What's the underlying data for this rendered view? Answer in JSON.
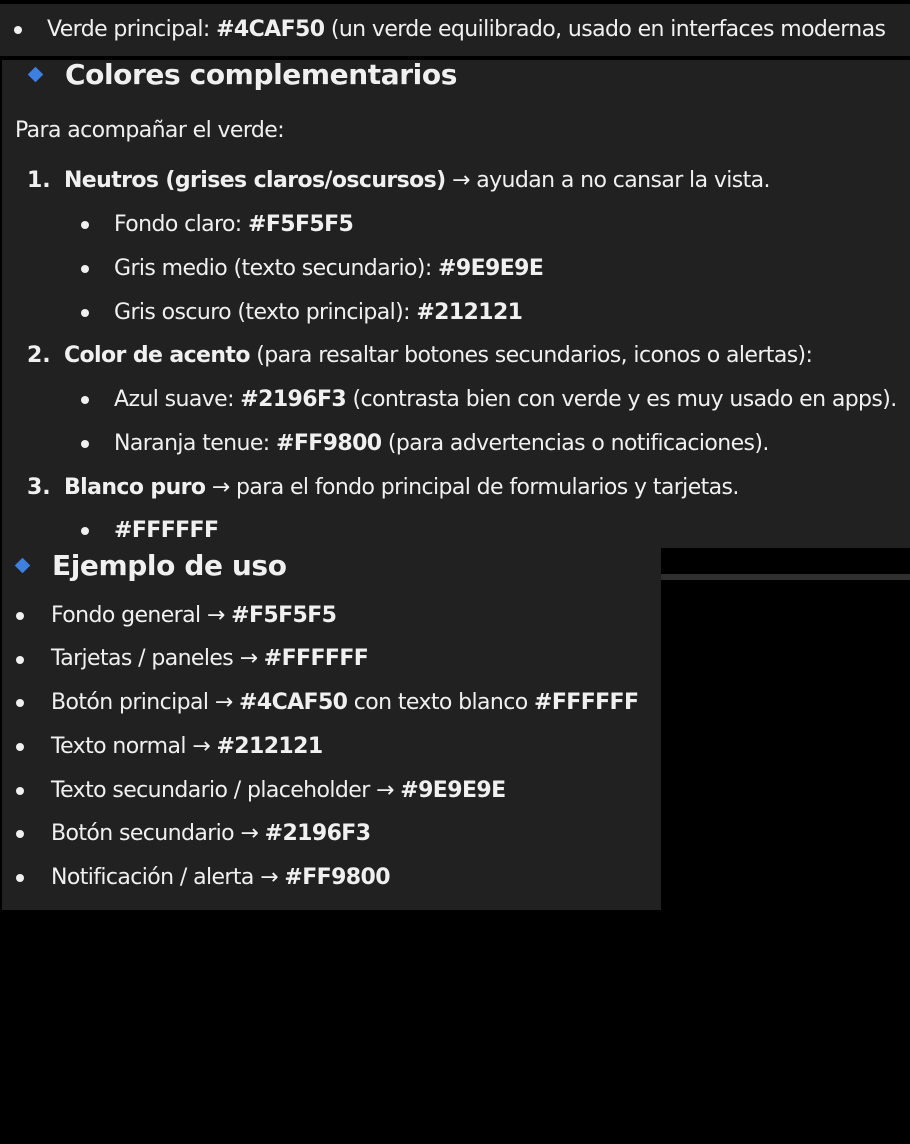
{
  "top_item": {
    "label": "Verde principal: ",
    "code": "#4CAF50",
    "rest": " (un verde equilibrado, usado en interfaces modernas"
  },
  "section1": {
    "heading": "Colores complementarios",
    "intro": "Para acompañar el verde:",
    "groups": [
      {
        "number": "1.",
        "title": "Neutros (grises claros/oscursos)",
        "rest": " → ayudan a no cansar la vista.",
        "items": [
          {
            "label": "Fondo claro: ",
            "code": "#F5F5F5",
            "rest": ""
          },
          {
            "label": "Gris medio (texto secundario): ",
            "code": "#9E9E9E",
            "rest": ""
          },
          {
            "label": "Gris oscuro (texto principal): ",
            "code": "#212121",
            "rest": ""
          }
        ]
      },
      {
        "number": "2.",
        "title": "Color de acento",
        "rest": " (para resaltar botones secundarios, iconos o alertas):",
        "items": [
          {
            "label": "Azul suave: ",
            "code": "#2196F3",
            "rest": " (contrasta bien con verde y es muy usado en apps)."
          },
          {
            "label": "Naranja tenue: ",
            "code": "#FF9800",
            "rest": " (para advertencias o notificaciones)."
          }
        ]
      },
      {
        "number": "3.",
        "title": "Blanco puro",
        "rest": " → para el fondo principal de formularios y tarjetas.",
        "items": [
          {
            "label": "",
            "code": "#FFFFFF",
            "rest": ""
          }
        ]
      }
    ]
  },
  "section2": {
    "heading": "Ejemplo de uso",
    "items": [
      {
        "label": "Fondo general → ",
        "code": "#F5F5F5",
        "rest": "",
        "code2": ""
      },
      {
        "label": "Tarjetas / paneles → ",
        "code": "#FFFFFF",
        "rest": "",
        "code2": ""
      },
      {
        "label": "Botón principal → ",
        "code": "#4CAF50",
        "rest": " con texto blanco ",
        "code2": "#FFFFFF"
      },
      {
        "label": "Texto normal → ",
        "code": "#212121",
        "rest": "",
        "code2": ""
      },
      {
        "label": "Texto secundario / placeholder → ",
        "code": "#9E9E9E",
        "rest": "",
        "code2": ""
      },
      {
        "label": "Botón secundario → ",
        "code": "#2196F3",
        "rest": "",
        "code2": ""
      },
      {
        "label": "Notificación / alerta → ",
        "code": "#FF9800",
        "rest": "",
        "code2": ""
      }
    ]
  },
  "colors": {
    "panel_background": "#212121",
    "page_background": "#000000",
    "text": "#F0F0F0",
    "accent_diamond": "#3F7FE0"
  },
  "icons": {
    "section_marker": "diamond-icon",
    "list_marker": "bullet-icon"
  }
}
